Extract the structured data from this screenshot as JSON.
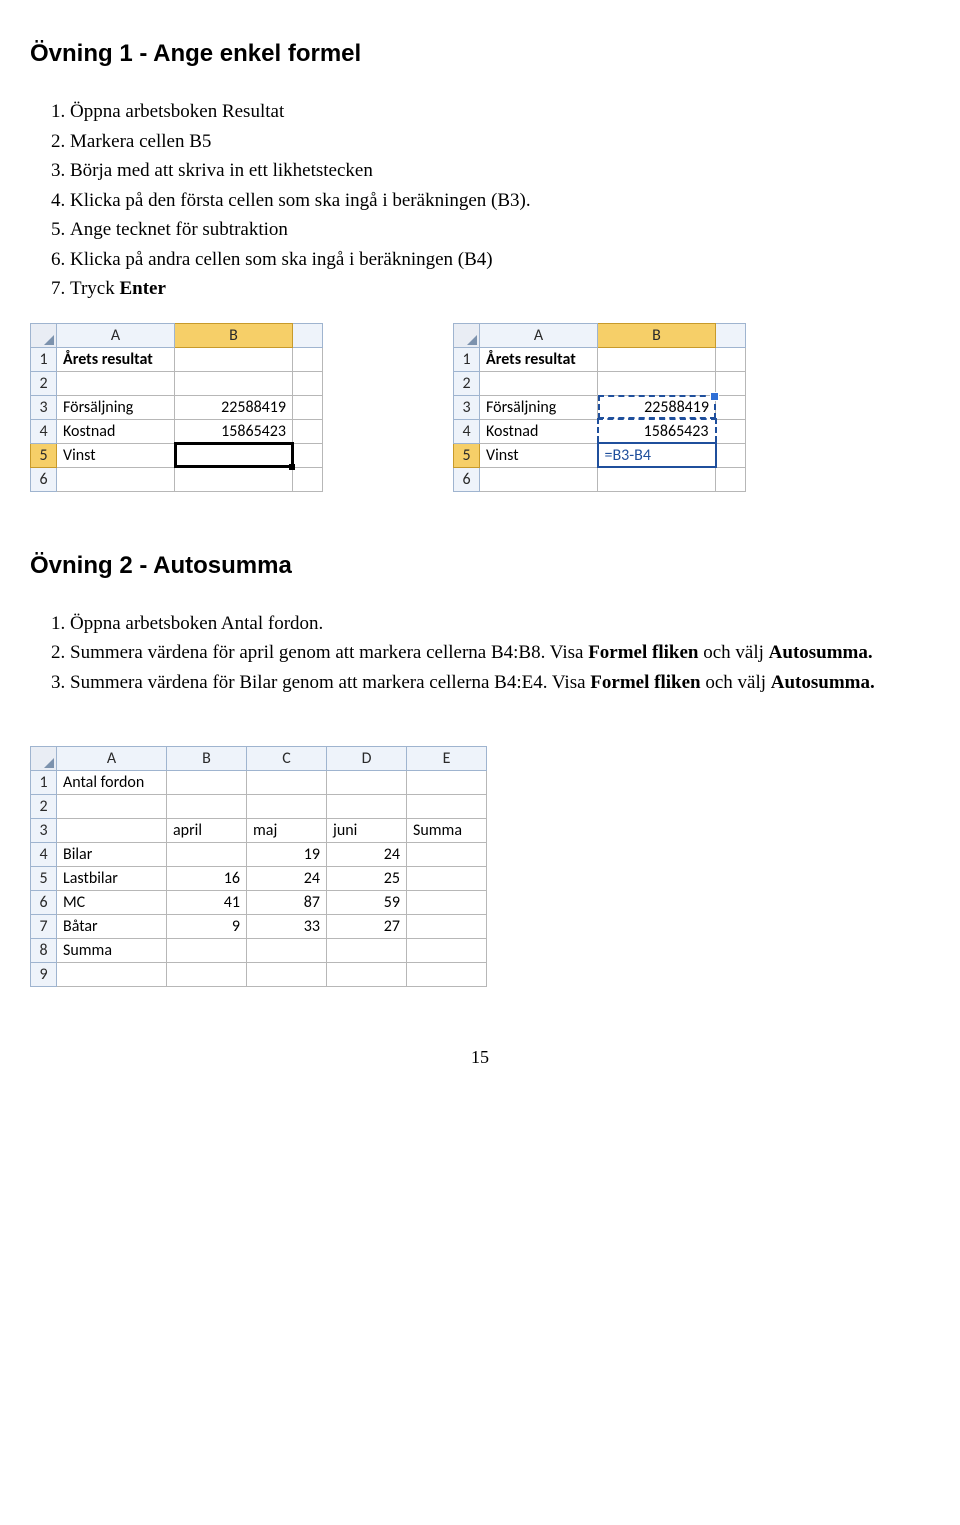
{
  "ex1": {
    "title": "Övning 1 - Ange enkel formel",
    "steps": [
      "Öppna arbetsboken Resultat",
      "Markera cellen B5",
      "Börja med att skriva in ett likhetstecken",
      "Klicka på den första cellen som ska ingå i beräkningen (B3).",
      "Ange tecknet för subtraktion",
      "Klicka på andra cellen som ska ingå  i beräkningen (B4)"
    ],
    "step7_prefix": "Tryck ",
    "step7_enter": "Enter"
  },
  "sheet1": {
    "cols": [
      "A",
      "B"
    ],
    "rows": [
      "1",
      "2",
      "3",
      "4",
      "5",
      "6"
    ],
    "a1": "Årets resultat",
    "a3": "Försäljning",
    "b3": "22588419",
    "a4": "Kostnad",
    "b4": "15865423",
    "a5": "Vinst",
    "b5": ""
  },
  "sheet2": {
    "cols": [
      "A",
      "B"
    ],
    "rows": [
      "1",
      "2",
      "3",
      "4",
      "5",
      "6"
    ],
    "a1": "Årets resultat",
    "a3": "Försäljning",
    "b3": "22588419",
    "a4": "Kostnad",
    "b4": "15865423",
    "a5": "Vinst",
    "b5": "=B3-B4"
  },
  "ex2": {
    "title": "Övning 2 - Autosumma",
    "step1": "Öppna arbetsboken Antal fordon.",
    "step2_a": "Summera värdena för april genom att markera cellerna B4:B8. Visa ",
    "step2_b": "Formel fliken",
    "step2_c": " och välj ",
    "step2_d": "Autosumma.",
    "step3_a": "Summera värdena för Bilar genom att markera cellerna B4:E4. Visa ",
    "step3_b": "Formel fliken",
    "step3_c": " och välj ",
    "step3_d": "Autosumma."
  },
  "sheet3": {
    "cols": [
      "A",
      "B",
      "C",
      "D",
      "E"
    ],
    "rows": [
      "1",
      "2",
      "3",
      "4",
      "5",
      "6",
      "7",
      "8",
      "9"
    ],
    "a1": "Antal fordon",
    "b3": "april",
    "c3": "maj",
    "d3": "juni",
    "e3": "Summa",
    "a4": "Bilar",
    "b4": "",
    "c4": "19",
    "d4": "24",
    "a5": "Lastbilar",
    "b5": "16",
    "c5": "24",
    "d5": "25",
    "a6": "MC",
    "b6": "41",
    "c6": "87",
    "d6": "59",
    "a7": "Båtar",
    "b7": "9",
    "c7": "33",
    "d7": "27",
    "a8": "Summa"
  },
  "page_number": "15"
}
